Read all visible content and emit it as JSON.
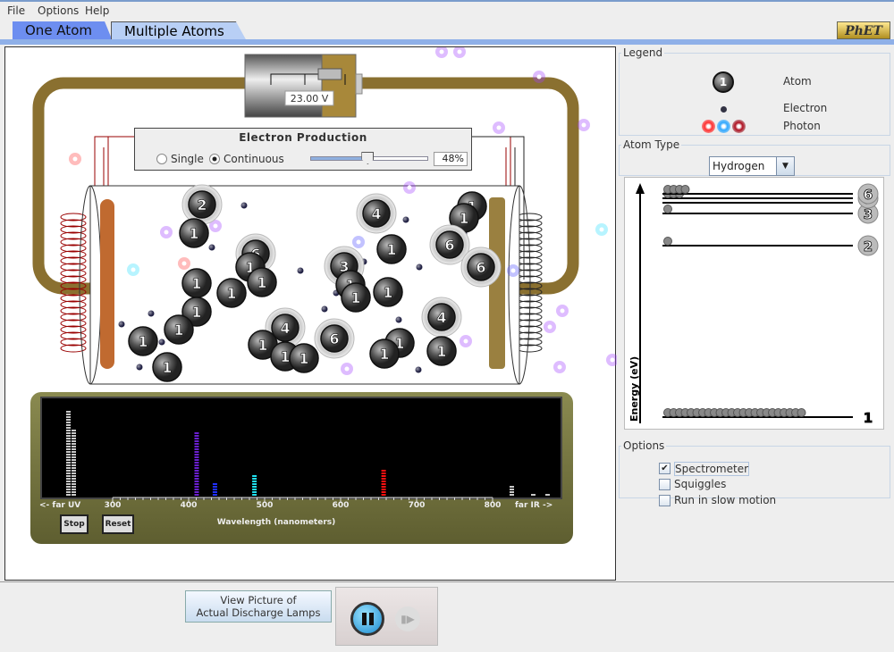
{
  "menu": {
    "file": "File",
    "options": "Options",
    "help": "Help"
  },
  "tabs": [
    {
      "label": "One Atom"
    },
    {
      "label": "Multiple Atoms",
      "selected": true
    }
  ],
  "logo": "PhET",
  "battery": {
    "voltage": "23.00 V"
  },
  "electron_production": {
    "title": "Electron Production",
    "single_label": "Single",
    "continuous_label": "Continuous",
    "mode": "Continuous",
    "rate_percent": 48,
    "rate_text": "48%"
  },
  "atoms": [
    "2",
    "1",
    "4",
    "1",
    "1",
    "1",
    "6",
    "6",
    "6",
    "1",
    "1",
    "1",
    "1",
    "1",
    "1",
    "1",
    "1",
    "3",
    "1",
    "1",
    "1",
    "4",
    "1",
    "1",
    "1",
    "6",
    "1",
    "1",
    "4",
    "1"
  ],
  "spectrometer": {
    "ticks": [
      "<- far UV",
      "300",
      "400",
      "500",
      "600",
      "700",
      "800",
      "far IR ->"
    ],
    "axis_label": "Wavelength (nanometers)",
    "stop_label": "Stop",
    "reset_label": "Reset",
    "lines": [
      {
        "wavelength": "far UV",
        "color": "#c8c8c8",
        "count": 32
      },
      {
        "wavelength": "far UV",
        "color": "#c8c8c8",
        "count": 25
      },
      {
        "wavelength": 410,
        "color": "#6a1fd0",
        "count": 24
      },
      {
        "wavelength": 434,
        "color": "#2030ff",
        "count": 5
      },
      {
        "wavelength": 486,
        "color": "#20e0f0",
        "count": 8
      },
      {
        "wavelength": 656,
        "color": "#ff1010",
        "count": 10
      },
      {
        "wavelength": "IR",
        "color": "#c8c8c8",
        "count": 4
      },
      {
        "wavelength": "far IR",
        "color": "#c8c8c8",
        "count": 1
      },
      {
        "wavelength": "far IR",
        "color": "#c8c8c8",
        "count": 1
      }
    ]
  },
  "legend": {
    "title": "Legend",
    "atom_label": "Atom",
    "atom_icon_text": "1",
    "electron_label": "Electron",
    "photon_label": "Photon",
    "photon_colors": [
      "#ff3030",
      "#30a8ff",
      "#b01020"
    ]
  },
  "atom_type": {
    "title": "Atom Type",
    "selected": "Hydrogen"
  },
  "energy_diagram": {
    "axis_label": "Energy (eV)",
    "levels": [
      {
        "n": "1",
        "atoms": 24
      },
      {
        "n": "2",
        "atoms": 1
      },
      {
        "n": "3",
        "atoms": 1
      },
      {
        "n": "4",
        "atoms": 0
      },
      {
        "n": "5",
        "atoms": 3
      },
      {
        "n": "6",
        "atoms": 4
      }
    ]
  },
  "options": {
    "title": "Options",
    "items": [
      {
        "label": "Spectrometer",
        "checked": true
      },
      {
        "label": "Squiggles",
        "checked": false
      },
      {
        "label": "Run in slow motion",
        "checked": false
      }
    ]
  },
  "bottom": {
    "lamps_line1": "View Picture of",
    "lamps_line2": "Actual Discharge Lamps",
    "pause_icon": "pause",
    "step_icon": "step"
  }
}
